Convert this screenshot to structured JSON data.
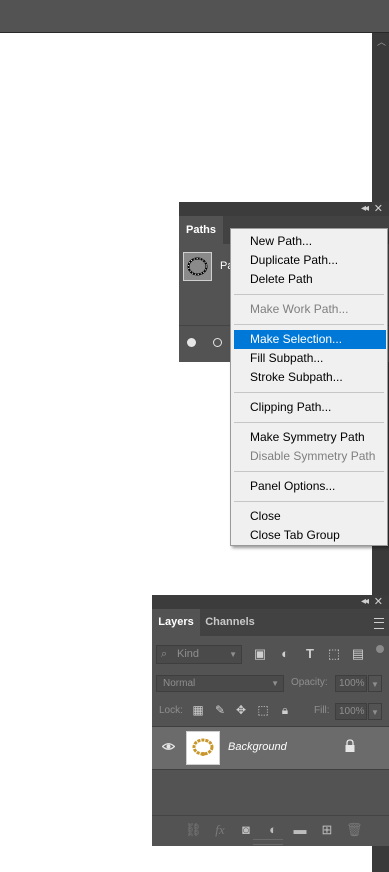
{
  "paths_panel": {
    "tab_label": "Paths",
    "path_name_partial": "Pa"
  },
  "context_menu": {
    "items": [
      {
        "label": "New Path...",
        "enabled": true
      },
      {
        "label": "Duplicate Path...",
        "enabled": true
      },
      {
        "label": "Delete Path",
        "enabled": true
      },
      {
        "label": "Make Work Path...",
        "enabled": false
      },
      {
        "label": "Make Selection...",
        "enabled": true,
        "highlighted": true
      },
      {
        "label": "Fill Subpath...",
        "enabled": true
      },
      {
        "label": "Stroke Subpath...",
        "enabled": true
      },
      {
        "label": "Clipping Path...",
        "enabled": true
      },
      {
        "label": "Make Symmetry Path",
        "enabled": true
      },
      {
        "label": "Disable Symmetry Path",
        "enabled": false
      },
      {
        "label": "Panel Options...",
        "enabled": true
      },
      {
        "label": "Close",
        "enabled": true
      },
      {
        "label": "Close Tab Group",
        "enabled": true
      }
    ]
  },
  "layers_panel": {
    "tabs": [
      {
        "label": "Layers",
        "active": true
      },
      {
        "label": "Channels",
        "active": false
      }
    ],
    "filter_kind": "Kind",
    "blend_mode": "Normal",
    "opacity_label": "Opacity:",
    "opacity_value": "100%",
    "lock_label": "Lock:",
    "fill_label": "Fill:",
    "fill_value": "100%",
    "layers": [
      {
        "name": "Background",
        "visible": true,
        "locked": true
      }
    ]
  },
  "colors": {
    "menu_highlight": "#0078d7",
    "panel_bg": "#535353",
    "menu_bg": "#f0f0f0"
  }
}
